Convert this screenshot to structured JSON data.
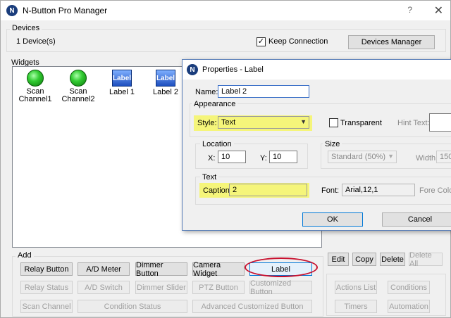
{
  "app": {
    "title": "N-Button Pro Manager",
    "logo": "N",
    "help": "?",
    "close": "✕"
  },
  "devices": {
    "label": "Devices",
    "count": "1 Device(s)",
    "keep_connection": "Keep Connection",
    "keep_connection_checked": true,
    "manager_button": "Devices Manager"
  },
  "widgets": {
    "label": "Widgets",
    "items": [
      {
        "name": "Scan\nChannel1",
        "icon": "led-green-icon"
      },
      {
        "name": "Scan\nChannel2",
        "icon": "led-green-icon"
      },
      {
        "name": "Label 1",
        "icon": "label-widget-icon"
      },
      {
        "name": "Label 2",
        "icon": "label-widget-icon"
      }
    ],
    "label_icon_text": "Label"
  },
  "add": {
    "label": "Add",
    "row1": [
      "Relay Button",
      "A/D Meter",
      "Dimmer Button",
      "Camera Widget",
      "Label"
    ],
    "row2": [
      "Relay Status",
      "A/D Switch",
      "Dimmer Slider",
      "PTZ Button",
      "Customized Button"
    ],
    "row3": [
      "Scan Channel",
      "Condition Status",
      "Advanced Customized Button"
    ]
  },
  "right_panel": {
    "row1": [
      "Edit",
      "Copy",
      "Delete",
      "Delete All"
    ],
    "row2": [
      "Actions List",
      "Conditions"
    ],
    "row3": [
      "Timers",
      "Automation"
    ]
  },
  "dialog": {
    "title": "Properties - Label",
    "logo": "N",
    "name_label": "Name:",
    "name_value": "Label 2",
    "appearance_label": "Appearance",
    "style_label": "Style:",
    "style_value": "Text",
    "transparent_label": "Transparent",
    "hint_label": "Hint Text:",
    "location_label": "Location",
    "x_label": "X:",
    "x_value": "10",
    "y_label": "Y:",
    "y_value": "10",
    "size_label": "Size",
    "size_value": "Standard    (50%)",
    "width_label": "Width:",
    "width_value": "150",
    "text_label": "Text",
    "caption_label": "Caption:",
    "caption_value": "2",
    "font_label": "Font:",
    "font_value": "Arial,12,1",
    "fore_color_label": "Fore Color",
    "ok": "OK",
    "cancel": "Cancel"
  },
  "colors": {
    "highlight": "#f5f57a",
    "annotation_oval": "#c8102e",
    "logo_blue": "#1a3d7c",
    "led_green": "#33cc33"
  }
}
